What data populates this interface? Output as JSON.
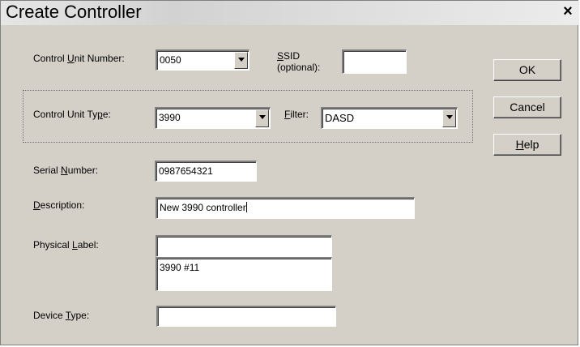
{
  "dialog": {
    "title": "Create Controller",
    "close_glyph": "×"
  },
  "control_unit_number": {
    "label_pre": "Control ",
    "label_key": "U",
    "label_post": "nit Number:",
    "value": "0050"
  },
  "ssid": {
    "label_key": "S",
    "label_post": "SID",
    "label_line2": "(optional):",
    "value": ""
  },
  "control_unit_type": {
    "label_pre": "Control Unit Ty",
    "label_key": "p",
    "label_post": "e:",
    "value": "3990"
  },
  "filter": {
    "label_key": "F",
    "label_post": "ilter:",
    "value": "DASD"
  },
  "serial_number": {
    "label_pre": "Serial ",
    "label_key": "N",
    "label_post": "umber:",
    "value": "0987654321"
  },
  "description": {
    "label_key": "D",
    "label_post": "escription:",
    "value": "New 3990 controller"
  },
  "physical_label": {
    "label_pre": "Physical ",
    "label_key": "L",
    "label_post": "abel:",
    "value_line1": "",
    "value_line2": "3990 #11"
  },
  "device_type": {
    "label_pre": "Device ",
    "label_key": "T",
    "label_post": "ype:",
    "value": ""
  },
  "buttons": {
    "ok": "OK",
    "cancel": "Cancel",
    "help_key": "H",
    "help_post": "elp"
  },
  "icons": {
    "dropdown": "chevron-down-icon",
    "close": "close-icon"
  }
}
